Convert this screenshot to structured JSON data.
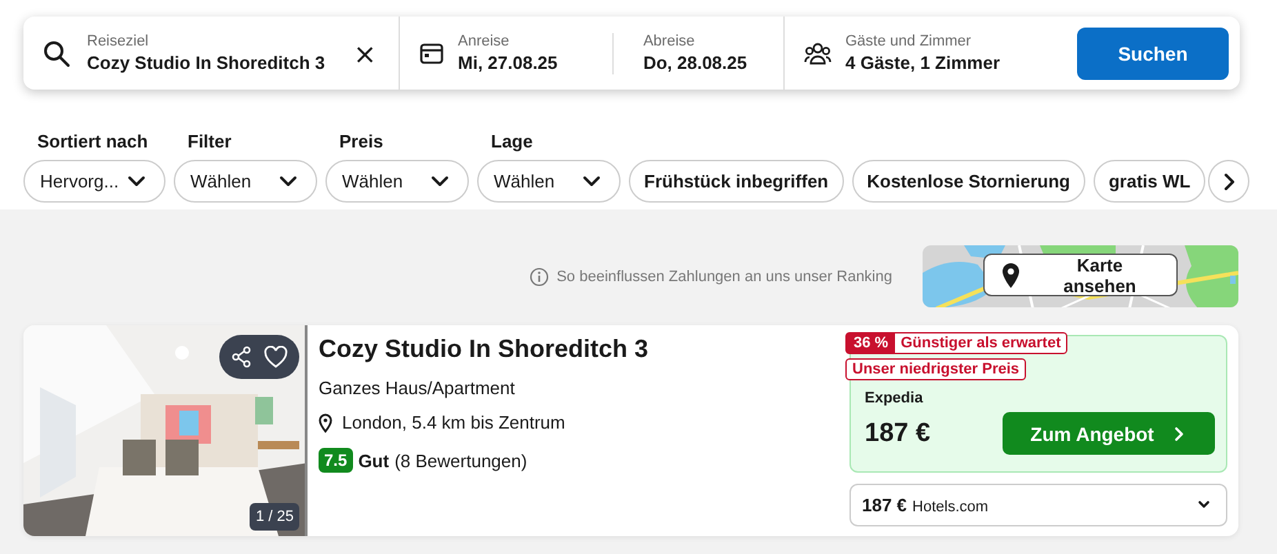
{
  "search": {
    "destination": {
      "label": "Reiseziel",
      "value": "Cozy Studio In Shoreditch 3",
      "clear": "×"
    },
    "checkin": {
      "label": "Anreise",
      "value": "Mi, 27.08.25"
    },
    "checkout": {
      "label": "Abreise",
      "value": "Do, 28.08.25"
    },
    "guests": {
      "label": "Gäste und Zimmer",
      "value": "4 Gäste, 1 Zimmer"
    },
    "button": "Suchen"
  },
  "filters": [
    {
      "label": "Sortiert nach",
      "value": "Hervorg..."
    },
    {
      "label": "Filter",
      "value": "Wählen"
    },
    {
      "label": "Preis",
      "value": "Wählen"
    },
    {
      "label": "Lage",
      "value": "Wählen"
    }
  ],
  "quick_filters": [
    "Frühstück inbegriffen",
    "Kostenlose Stornierung",
    "gratis WL"
  ],
  "ranking_note": "So beeinflussen Zahlungen an uns unser Ranking",
  "map_button": "Karte ansehen",
  "listing": {
    "title": "Cozy Studio In Shoreditch 3",
    "type": "Ganzes Haus/Apartment",
    "location": "London, 5.4 km bis Zentrum",
    "rating": {
      "score": "7.5",
      "label": "Gut",
      "count": "(8 Bewertungen)"
    },
    "photo_counter": "1 / 25",
    "badges": [
      {
        "kind": "discount",
        "percent": "36 %",
        "text": "Günstiger als erwartet"
      },
      {
        "kind": "outline",
        "text": "Unser niedrigster Preis"
      }
    ],
    "offer": {
      "provider": "Expedia",
      "price": "187 €",
      "button": "Zum Angebot"
    },
    "alt_offer": {
      "price": "187 €",
      "provider": "Hotels.com"
    }
  }
}
